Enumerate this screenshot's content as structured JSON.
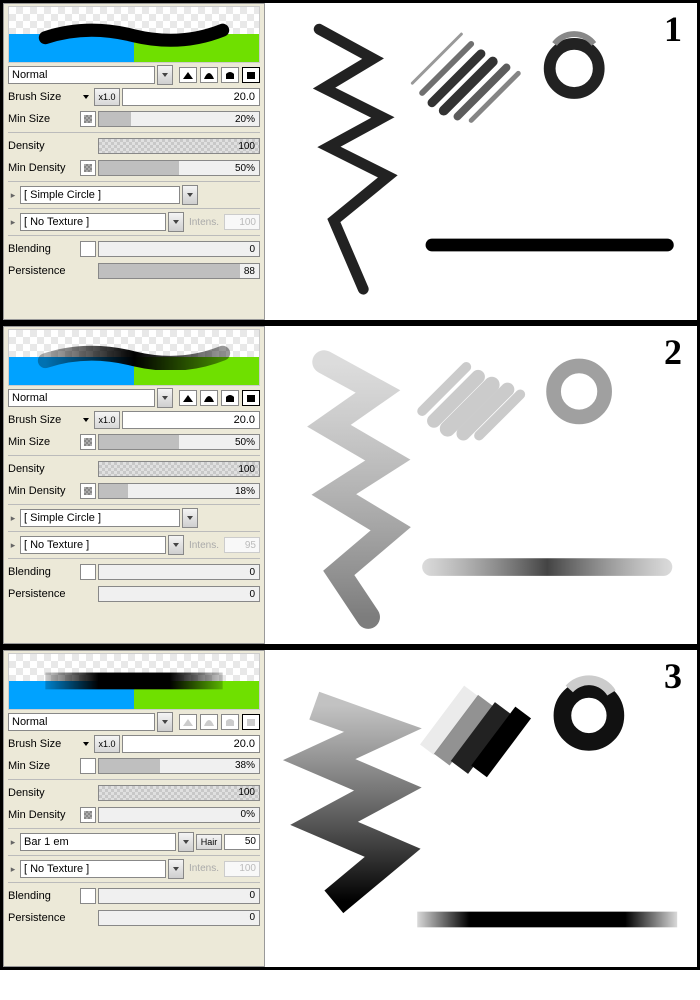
{
  "sections": [
    {
      "num": "1",
      "blend_mode": "Normal",
      "brush_size_label": "Brush Size",
      "mult": "x1.0",
      "brush_size": "20.0",
      "min_size_label": "Min Size",
      "min_size": "20%",
      "min_size_fill": 20,
      "min_size_chk": true,
      "density_label": "Density",
      "density": "100",
      "density_fill": 100,
      "min_density_label": "Min Density",
      "min_density": "50%",
      "min_density_fill": 50,
      "min_density_chk": true,
      "tip": "[ Simple Circle ]",
      "texture": "[ No Texture ]",
      "intens_label": "Intens.",
      "intens": "100",
      "hair_visible": false,
      "blending_label": "Blending",
      "blending": "0",
      "blending_fill": 0,
      "persistence_label": "Persistence",
      "persistence": "88",
      "persistence_fill": 88,
      "shape_grey": false
    },
    {
      "num": "2",
      "blend_mode": "Normal",
      "brush_size_label": "Brush Size",
      "mult": "x1.0",
      "brush_size": "20.0",
      "min_size_label": "Min Size",
      "min_size": "50%",
      "min_size_fill": 50,
      "min_size_chk": true,
      "density_label": "Density",
      "density": "100",
      "density_fill": 100,
      "min_density_label": "Min Density",
      "min_density": "18%",
      "min_density_fill": 18,
      "min_density_chk": true,
      "tip": "[ Simple Circle ]",
      "texture": "[ No Texture ]",
      "intens_label": "Intens.",
      "intens": "95",
      "hair_visible": false,
      "blending_label": "Blending",
      "blending": "0",
      "blending_fill": 0,
      "persistence_label": "Persistence",
      "persistence": "0",
      "persistence_fill": 0,
      "shape_grey": false
    },
    {
      "num": "3",
      "blend_mode": "Normal",
      "brush_size_label": "Brush Size",
      "mult": "x1.0",
      "brush_size": "20.0",
      "min_size_label": "Min Size",
      "min_size": "38%",
      "min_size_fill": 38,
      "min_size_chk": false,
      "density_label": "Density",
      "density": "100",
      "density_fill": 100,
      "min_density_label": "Min Density",
      "min_density": "0%",
      "min_density_fill": 0,
      "min_density_chk": true,
      "tip": "Bar 1 em",
      "texture": "[ No Texture ]",
      "intens_label": "Intens.",
      "intens": "100",
      "hair_visible": true,
      "hair_label": "Hair",
      "hair": "50",
      "blending_label": "Blending",
      "blending": "0",
      "blending_fill": 0,
      "persistence_label": "Persistence",
      "persistence": "0",
      "persistence_fill": 0,
      "shape_grey": true
    }
  ]
}
